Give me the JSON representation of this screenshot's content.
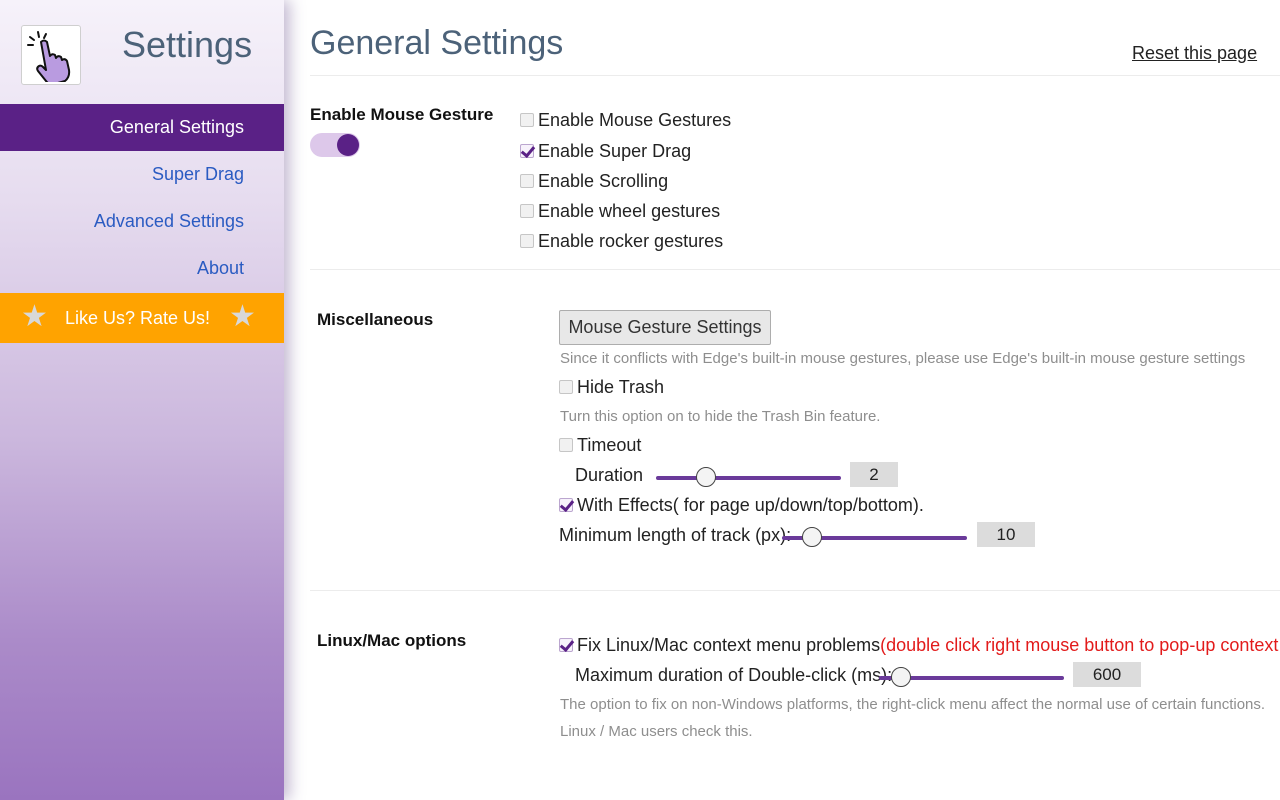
{
  "sidebar": {
    "brand_title": "Settings",
    "logo_icon": "hand-pointer-icon",
    "items": [
      {
        "label": "General Settings",
        "active": true
      },
      {
        "label": "Super Drag",
        "active": false
      },
      {
        "label": "Advanced Settings",
        "active": false
      },
      {
        "label": "About",
        "active": false
      }
    ],
    "rate_label": "Like Us? Rate Us!",
    "star_glyph": "★"
  },
  "header": {
    "title": "General Settings",
    "reset_label": "Reset this page"
  },
  "gesture_section": {
    "label": "Enable Mouse Gesture",
    "toggle_on": true,
    "options": [
      {
        "label": "Enable Mouse Gestures",
        "checked": false
      },
      {
        "label": "Enable Super Drag",
        "checked": true
      },
      {
        "label": "Enable Scrolling",
        "checked": false
      },
      {
        "label": "Enable wheel gestures",
        "checked": false
      },
      {
        "label": "Enable rocker gestures",
        "checked": false
      }
    ]
  },
  "misc_section": {
    "label": "Miscellaneous",
    "button_label": "Mouse Gesture Settings",
    "button_hint": "Since it conflicts with Edge's built-in mouse gestures, please use Edge's built-in mouse gesture settings",
    "hide_trash_label": "Hide Trash",
    "hide_trash_checked": false,
    "hide_trash_hint": "Turn this option on to hide the Trash Bin feature.",
    "timeout_label": "Timeout",
    "timeout_checked": false,
    "duration_label": "Duration",
    "duration_value": "2",
    "duration_fraction": 0.27,
    "effects_label": "With Effects( for page up/down/top/bottom).",
    "effects_checked": true,
    "min_track_label": "Minimum length of track (px):",
    "min_track_value": "10",
    "min_track_fraction": 0.16
  },
  "linux_section": {
    "label": "Linux/Mac options",
    "fix_label": "Fix Linux/Mac context menu problems",
    "fix_note": "(double click right mouse button to pop-up context menu)",
    "fix_checked": true,
    "dblclick_label": "Maximum duration of Double-click (ms):",
    "dblclick_value": "600",
    "dblclick_fraction": 0.12,
    "hint_line1": "The option to fix on non-Windows platforms, the right-click menu affect the normal use of certain functions.",
    "hint_line2": "Linux / Mac users check this."
  },
  "colors": {
    "accent": "#5a2186",
    "rate_bg": "#ffa300",
    "link": "#2a5bc2",
    "warning": "#e21b1b"
  }
}
